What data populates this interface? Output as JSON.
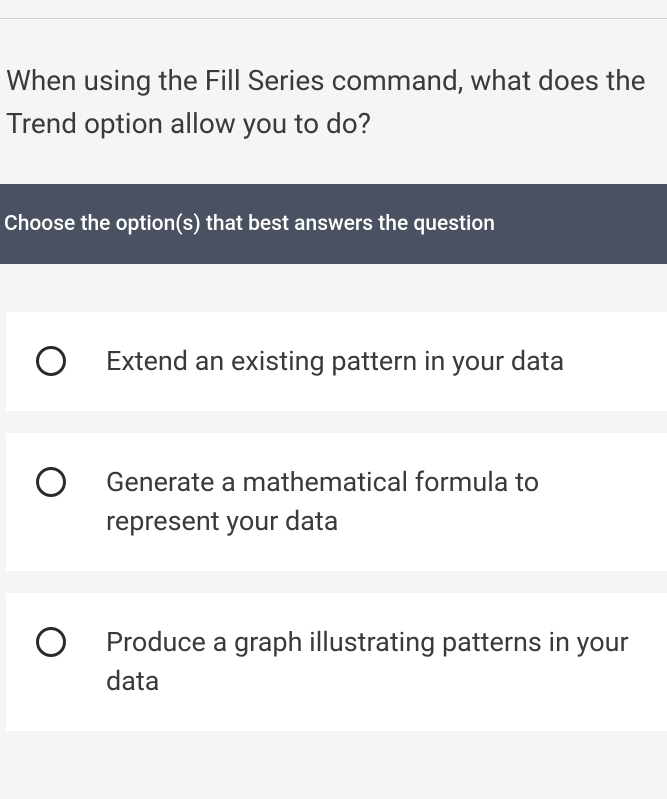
{
  "question": "When using the Fill Series command, what does the Trend option allow you to do?",
  "instruction": "Choose the option(s) that best answers the question",
  "options": [
    {
      "label": "Extend an existing pattern in your data"
    },
    {
      "label": "Generate a mathematical formula to represent your data"
    },
    {
      "label": "Produce a graph illustrating patterns in your data"
    }
  ]
}
